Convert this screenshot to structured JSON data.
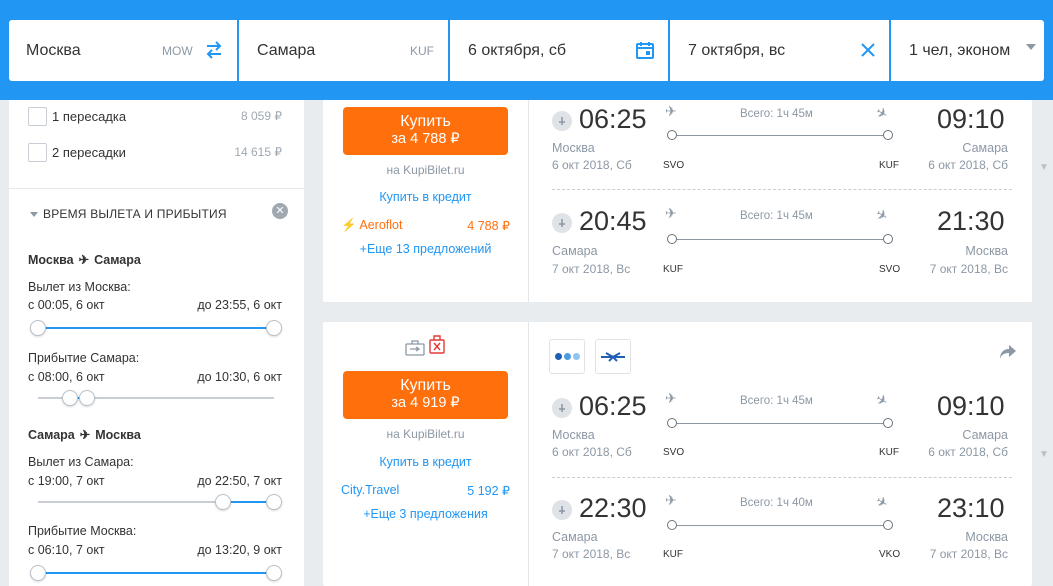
{
  "search": {
    "origin": {
      "city": "Москва",
      "code": "MOW"
    },
    "destination": {
      "city": "Самара",
      "code": "KUF"
    },
    "depart_date": "6 октября, сб",
    "return_date": "7 октября, вс",
    "passengers": "1 чел, эконом"
  },
  "filters": {
    "stops": [
      {
        "label": "1 пересадка",
        "price": "8 059 ₽"
      },
      {
        "label": "2 пересадки",
        "price": "14 615 ₽"
      }
    ],
    "time_section_title": "ВРЕМЯ ВЫЛЕТА И ПРИБЫТИЯ",
    "leg1": {
      "from": "Москва",
      "to": "Самара",
      "depart_label": "Вылет из Москва:",
      "depart_from": "с 00:05, 6 окт",
      "depart_to": "до 23:55, 6 окт",
      "arrive_label": "Прибытие Самара:",
      "arrive_from": "с 08:00, 6 окт",
      "arrive_to": "до 10:30, 6 окт"
    },
    "leg2": {
      "from": "Самара",
      "to": "Москва",
      "depart_label": "Вылет из Самара:",
      "depart_from": "с 19:00, 7 окт",
      "depart_to": "до 22:50, 7 окт",
      "arrive_label": "Прибытие Москва:",
      "arrive_from": "с 06:10, 7 окт",
      "arrive_to": "до 13:20, 9 окт"
    }
  },
  "results": [
    {
      "buy_label": "Купить",
      "buy_price": "за 4 788 ₽",
      "agency": "на KupiBilet.ru",
      "credit": "Купить в кредит",
      "offer_name": "Aeroflot",
      "offer_price": "4 788 ₽",
      "more": "+Еще 13 предложений",
      "out": {
        "dep_time": "06:25",
        "arr_time": "09:10",
        "total": "Всего: 1ч 45м",
        "dep_city": "Москва",
        "arr_city": "Самара",
        "dep_date": "6 окт 2018, Сб",
        "arr_date": "6 окт 2018, Сб",
        "dep_code": "SVO",
        "arr_code": "KUF"
      },
      "ret": {
        "dep_time": "20:45",
        "arr_time": "21:30",
        "total": "Всего: 1ч 45м",
        "dep_city": "Самара",
        "arr_city": "Москва",
        "dep_date": "7 окт 2018, Вс",
        "arr_date": "7 окт 2018, Вс",
        "dep_code": "KUF",
        "arr_code": "SVO"
      }
    },
    {
      "buy_label": "Купить",
      "buy_price": "за 4 919 ₽",
      "agency": "на KupiBilet.ru",
      "credit": "Купить в кредит",
      "offer_name": "City.Travel",
      "offer_price": "5 192 ₽",
      "more": "+Еще 3 предложения",
      "out": {
        "dep_time": "06:25",
        "arr_time": "09:10",
        "total": "Всего: 1ч 45м",
        "dep_city": "Москва",
        "arr_city": "Самара",
        "dep_date": "6 окт 2018, Сб",
        "arr_date": "6 окт 2018, Сб",
        "dep_code": "SVO",
        "arr_code": "KUF"
      },
      "ret": {
        "dep_time": "22:30",
        "arr_time": "23:10",
        "total": "Всего: 1ч 40м",
        "dep_city": "Самара",
        "arr_city": "Москва",
        "dep_date": "7 окт 2018, Вс",
        "arr_date": "7 окт 2018, Вс",
        "dep_code": "KUF",
        "arr_code": "VKO"
      }
    }
  ],
  "colors": {
    "accent": "#2196f3",
    "buy": "#ff6f0c"
  }
}
